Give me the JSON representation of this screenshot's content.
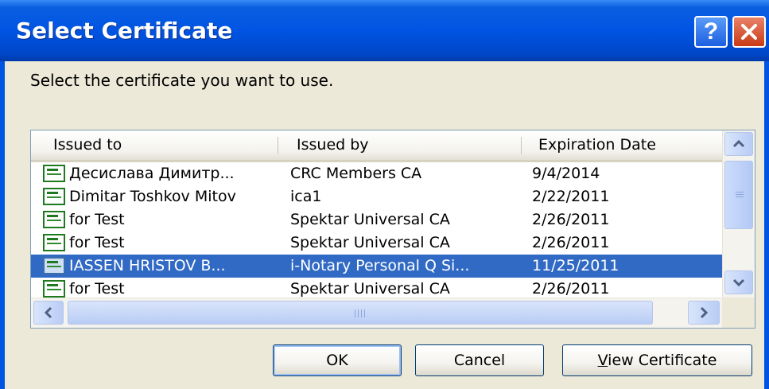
{
  "window": {
    "title": "Select Certificate",
    "help_glyph": "?",
    "colors": {
      "titlebar": "#0054e3",
      "selection": "#316ac5",
      "dialog_bg": "#ece9d8"
    }
  },
  "prompt": "Select the certificate you want to use.",
  "list": {
    "columns": [
      "Issued to",
      "Issued by",
      "Expiration Date"
    ],
    "rows": [
      {
        "issued_to": "Десислава Димитр...",
        "issued_by": "CRC Members CA",
        "expiration": "9/4/2014",
        "selected": false
      },
      {
        "issued_to": "Dimitar Toshkov Mitov",
        "issued_by": "ica1",
        "expiration": "2/22/2011",
        "selected": false
      },
      {
        "issued_to": "for Test",
        "issued_by": "Spektar Universal CA",
        "expiration": "2/26/2011",
        "selected": false
      },
      {
        "issued_to": "for Test",
        "issued_by": "Spektar Universal CA",
        "expiration": "2/26/2011",
        "selected": false
      },
      {
        "issued_to": "IASSEN HRISTOV B...",
        "issued_by": "i-Notary Personal Q Si...",
        "expiration": "11/25/2011",
        "selected": true
      },
      {
        "issued_to": "for Test",
        "issued_by": "Spektar Universal CA",
        "expiration": "2/26/2011",
        "selected": false
      }
    ]
  },
  "buttons": {
    "ok": "OK",
    "cancel": "Cancel",
    "view_mnemonic": "V",
    "view_rest": "iew Certificate"
  },
  "icons": {
    "row_icon": "certificate-icon",
    "help": "help-icon",
    "close": "close-icon"
  }
}
